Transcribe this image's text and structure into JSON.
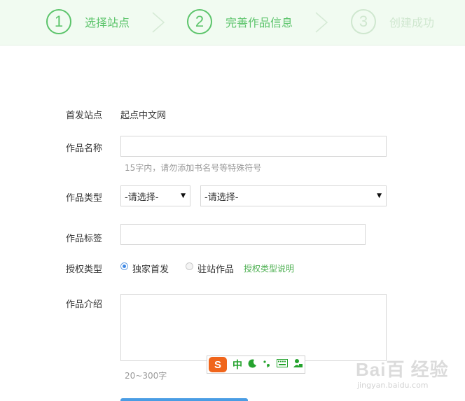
{
  "steps": [
    {
      "num": "1",
      "label": "选择站点",
      "state": "done"
    },
    {
      "num": "2",
      "label": "完善作品信息",
      "state": "active"
    },
    {
      "num": "3",
      "label": "创建成功",
      "state": "pending"
    }
  ],
  "form": {
    "site_label": "首发站点",
    "site_value": "起点中文网",
    "name_label": "作品名称",
    "name_value": "",
    "name_hint": "15字内，请勿添加书名号等特殊符号",
    "type_label": "作品类型",
    "type_select1": "-请选择-",
    "type_select2": "-请选择-",
    "tags_label": "作品标签",
    "tags_value": "",
    "auth_label": "授权类型",
    "auth_options": [
      {
        "label": "独家首发",
        "checked": true
      },
      {
        "label": "驻站作品",
        "checked": false
      }
    ],
    "auth_link": "授权类型说明",
    "intro_label": "作品介绍",
    "intro_value": "",
    "intro_hint": "20~300字"
  },
  "ime": {
    "logo": "S",
    "mode": "中",
    "icons": [
      "moon-icon",
      "punctuation-icon",
      "keyboard-icon",
      "user-icon"
    ]
  },
  "watermark": {
    "brand": "Bai百 经验",
    "sub": "jingyan.baidu.com"
  },
  "colors": {
    "accent_green": "#5cc46b",
    "stepper_bg": "#f1fbf1",
    "link_green": "#4caf50",
    "radio_blue": "#3d88e5",
    "submit_blue": "#4a9de4"
  }
}
